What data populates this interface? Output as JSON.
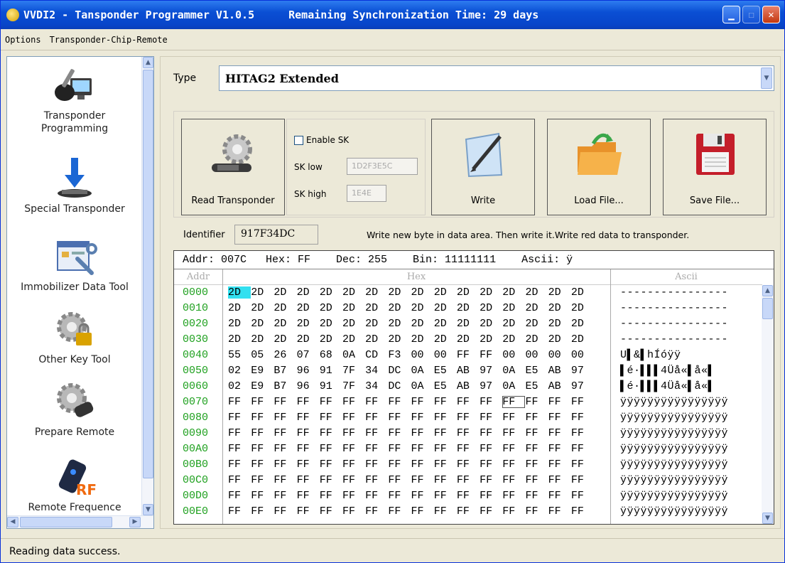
{
  "window": {
    "title": "VVDI2 - Tansponder Programmer V1.0.5",
    "sync_text": "Remaining Synchronization Time: 29 days"
  },
  "menu": {
    "items": [
      "Options",
      "Transponder-Chip-Remote"
    ]
  },
  "sidebar": {
    "items": [
      {
        "label": "Transponder\nProgramming",
        "icon": "car-key-computer-icon"
      },
      {
        "label": "Special Transponder",
        "icon": "download-chip-icon"
      },
      {
        "label": "Immobilizer Data Tool",
        "icon": "tools-window-icon"
      },
      {
        "label": "Other Key Tool",
        "icon": "gear-lock-icon"
      },
      {
        "label": "Prepare Remote",
        "icon": "gear-remote-icon"
      },
      {
        "label": "Remote Frequence",
        "icon": "rf-remote-icon"
      }
    ]
  },
  "type_row": {
    "label": "Type",
    "value": "HITAG2 Extended"
  },
  "buttons": {
    "read": "Read Transponder",
    "write": "Write",
    "load": "Load File...",
    "save": "Save File..."
  },
  "sk": {
    "enable_label": "Enable SK",
    "low_label": "SK low",
    "low_value": "1D2F3E5C",
    "high_label": "SK high",
    "high_value": "1E4E"
  },
  "identifier": {
    "label": "Identifier",
    "value": "917F34DC"
  },
  "hint": "Write new byte in data area. Then write it.Write red data to transponder.",
  "hex_status": "Addr: 007C   Hex: FF    Dec: 255    Bin: 11111111    Ascii: ÿ",
  "hex_headers": {
    "addr": "Addr",
    "hex": "Hex",
    "ascii": "Ascii"
  },
  "hex_rows": [
    {
      "addr": "0000",
      "bytes": [
        "2D",
        "2D",
        "2D",
        "2D",
        "2D",
        "2D",
        "2D",
        "2D",
        "2D",
        "2D",
        "2D",
        "2D",
        "2D",
        "2D",
        "2D",
        "2D"
      ],
      "ascii": "----------------"
    },
    {
      "addr": "0010",
      "bytes": [
        "2D",
        "2D",
        "2D",
        "2D",
        "2D",
        "2D",
        "2D",
        "2D",
        "2D",
        "2D",
        "2D",
        "2D",
        "2D",
        "2D",
        "2D",
        "2D"
      ],
      "ascii": "----------------"
    },
    {
      "addr": "0020",
      "bytes": [
        "2D",
        "2D",
        "2D",
        "2D",
        "2D",
        "2D",
        "2D",
        "2D",
        "2D",
        "2D",
        "2D",
        "2D",
        "2D",
        "2D",
        "2D",
        "2D"
      ],
      "ascii": "----------------"
    },
    {
      "addr": "0030",
      "bytes": [
        "2D",
        "2D",
        "2D",
        "2D",
        "2D",
        "2D",
        "2D",
        "2D",
        "2D",
        "2D",
        "2D",
        "2D",
        "2D",
        "2D",
        "2D",
        "2D"
      ],
      "ascii": "----------------"
    },
    {
      "addr": "0040",
      "bytes": [
        "55",
        "05",
        "26",
        "07",
        "68",
        "0A",
        "CD",
        "F3",
        "00",
        "00",
        "FF",
        "FF",
        "00",
        "00",
        "00",
        "00"
      ],
      "ascii": "U▌&▌hÍóÿÿ"
    },
    {
      "addr": "0050",
      "bytes": [
        "02",
        "E9",
        "B7",
        "96",
        "91",
        "7F",
        "34",
        "DC",
        "0A",
        "E5",
        "AB",
        "97",
        "0A",
        "E5",
        "AB",
        "97"
      ],
      "ascii": "▌é·▌▌▌4Üå«▌å«▌"
    },
    {
      "addr": "0060",
      "bytes": [
        "02",
        "E9",
        "B7",
        "96",
        "91",
        "7F",
        "34",
        "DC",
        "0A",
        "E5",
        "AB",
        "97",
        "0A",
        "E5",
        "AB",
        "97"
      ],
      "ascii": "▌é·▌▌▌4Üå«▌å«▌"
    },
    {
      "addr": "0070",
      "bytes": [
        "FF",
        "FF",
        "FF",
        "FF",
        "FF",
        "FF",
        "FF",
        "FF",
        "FF",
        "FF",
        "FF",
        "FF",
        "FF",
        "FF",
        "FF",
        "FF"
      ],
      "ascii": "ÿÿÿÿÿÿÿÿÿÿÿÿÿÿÿÿ"
    },
    {
      "addr": "0080",
      "bytes": [
        "FF",
        "FF",
        "FF",
        "FF",
        "FF",
        "FF",
        "FF",
        "FF",
        "FF",
        "FF",
        "FF",
        "FF",
        "FF",
        "FF",
        "FF",
        "FF"
      ],
      "ascii": "ÿÿÿÿÿÿÿÿÿÿÿÿÿÿÿÿ"
    },
    {
      "addr": "0090",
      "bytes": [
        "FF",
        "FF",
        "FF",
        "FF",
        "FF",
        "FF",
        "FF",
        "FF",
        "FF",
        "FF",
        "FF",
        "FF",
        "FF",
        "FF",
        "FF",
        "FF"
      ],
      "ascii": "ÿÿÿÿÿÿÿÿÿÿÿÿÿÿÿÿ"
    },
    {
      "addr": "00A0",
      "bytes": [
        "FF",
        "FF",
        "FF",
        "FF",
        "FF",
        "FF",
        "FF",
        "FF",
        "FF",
        "FF",
        "FF",
        "FF",
        "FF",
        "FF",
        "FF",
        "FF"
      ],
      "ascii": "ÿÿÿÿÿÿÿÿÿÿÿÿÿÿÿÿ"
    },
    {
      "addr": "00B0",
      "bytes": [
        "FF",
        "FF",
        "FF",
        "FF",
        "FF",
        "FF",
        "FF",
        "FF",
        "FF",
        "FF",
        "FF",
        "FF",
        "FF",
        "FF",
        "FF",
        "FF"
      ],
      "ascii": "ÿÿÿÿÿÿÿÿÿÿÿÿÿÿÿÿ"
    },
    {
      "addr": "00C0",
      "bytes": [
        "FF",
        "FF",
        "FF",
        "FF",
        "FF",
        "FF",
        "FF",
        "FF",
        "FF",
        "FF",
        "FF",
        "FF",
        "FF",
        "FF",
        "FF",
        "FF"
      ],
      "ascii": "ÿÿÿÿÿÿÿÿÿÿÿÿÿÿÿÿ"
    },
    {
      "addr": "00D0",
      "bytes": [
        "FF",
        "FF",
        "FF",
        "FF",
        "FF",
        "FF",
        "FF",
        "FF",
        "FF",
        "FF",
        "FF",
        "FF",
        "FF",
        "FF",
        "FF",
        "FF"
      ],
      "ascii": "ÿÿÿÿÿÿÿÿÿÿÿÿÿÿÿÿ"
    },
    {
      "addr": "00E0",
      "bytes": [
        "FF",
        "FF",
        "FF",
        "FF",
        "FF",
        "FF",
        "FF",
        "FF",
        "FF",
        "FF",
        "FF",
        "FF",
        "FF",
        "FF",
        "FF",
        "FF"
      ],
      "ascii": "ÿÿÿÿÿÿÿÿÿÿÿÿÿÿÿÿ"
    }
  ],
  "status": "Reading data success.",
  "colors": {
    "titlebar": "#0a4fd4",
    "addr_green": "#1ea01e",
    "selection": "#32e0f0"
  }
}
